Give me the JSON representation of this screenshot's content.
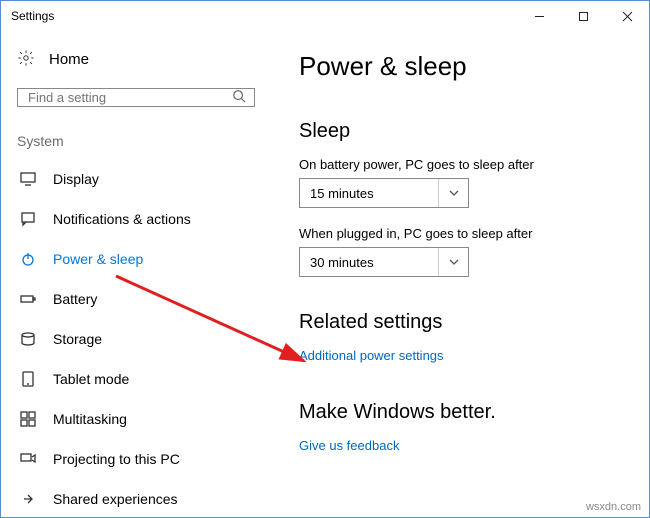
{
  "window": {
    "title": "Settings"
  },
  "sidebar": {
    "home": "Home",
    "search_placeholder": "Find a setting",
    "group": "System",
    "items": [
      {
        "label": "Display"
      },
      {
        "label": "Notifications & actions"
      },
      {
        "label": "Power & sleep"
      },
      {
        "label": "Battery"
      },
      {
        "label": "Storage"
      },
      {
        "label": "Tablet mode"
      },
      {
        "label": "Multitasking"
      },
      {
        "label": "Projecting to this PC"
      },
      {
        "label": "Shared experiences"
      }
    ]
  },
  "main": {
    "title": "Power & sleep",
    "sleep": {
      "heading": "Sleep",
      "battery_label": "On battery power, PC goes to sleep after",
      "battery_value": "15 minutes",
      "plugged_label": "When plugged in, PC goes to sleep after",
      "plugged_value": "30 minutes"
    },
    "related": {
      "heading": "Related settings",
      "link": "Additional power settings"
    },
    "better": {
      "heading": "Make Windows better.",
      "link": "Give us feedback"
    }
  },
  "watermark": "wsxdn.com"
}
